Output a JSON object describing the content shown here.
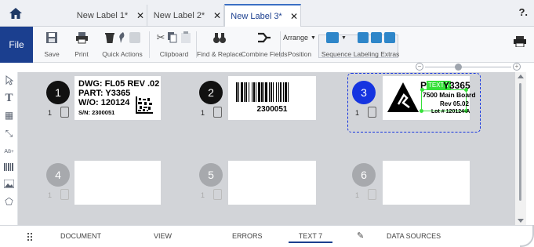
{
  "tabs": [
    {
      "label": "New Label 1*"
    },
    {
      "label": "New Label 2*"
    },
    {
      "label": "New Label 3*"
    }
  ],
  "help_label": "?.",
  "ribbon": {
    "file": "File",
    "groups": [
      "Save",
      "Print",
      "Quick Actions",
      "Clipboard",
      "Find & Replace",
      "Combine Fields",
      "Position",
      "Sequence",
      "Labeling Extras"
    ],
    "arrange": "Arrange"
  },
  "labels": [
    {
      "number": "1",
      "copies": "1"
    },
    {
      "number": "2",
      "copies": "1"
    },
    {
      "number": "3",
      "copies": "1"
    },
    {
      "number": "4",
      "copies": "1"
    },
    {
      "number": "5",
      "copies": "1"
    },
    {
      "number": "6",
      "copies": "1"
    }
  ],
  "label1": {
    "dwg": "DWG: FL05 REV .02",
    "part": "PART: Y3365",
    "wo": "W/O: 120124",
    "sn": "S/N: 2300051"
  },
  "label2": {
    "barcode_text": "2300051"
  },
  "label3": {
    "part": "P",
    "text_tag": "TEXT 7",
    "part_suffix": "Y3365",
    "board": "7500 Main Board",
    "rev": "Rev 05.02",
    "lot": "Lot # 120124-A"
  },
  "bottom": {
    "items": [
      "DOCUMENT",
      "VIEW",
      "ERRORS",
      "TEXT 7",
      "DATA SOURCES"
    ]
  },
  "colors": {
    "accent": "#1b3f8f",
    "selection": "#1534e0",
    "tag": "#36e03a"
  }
}
